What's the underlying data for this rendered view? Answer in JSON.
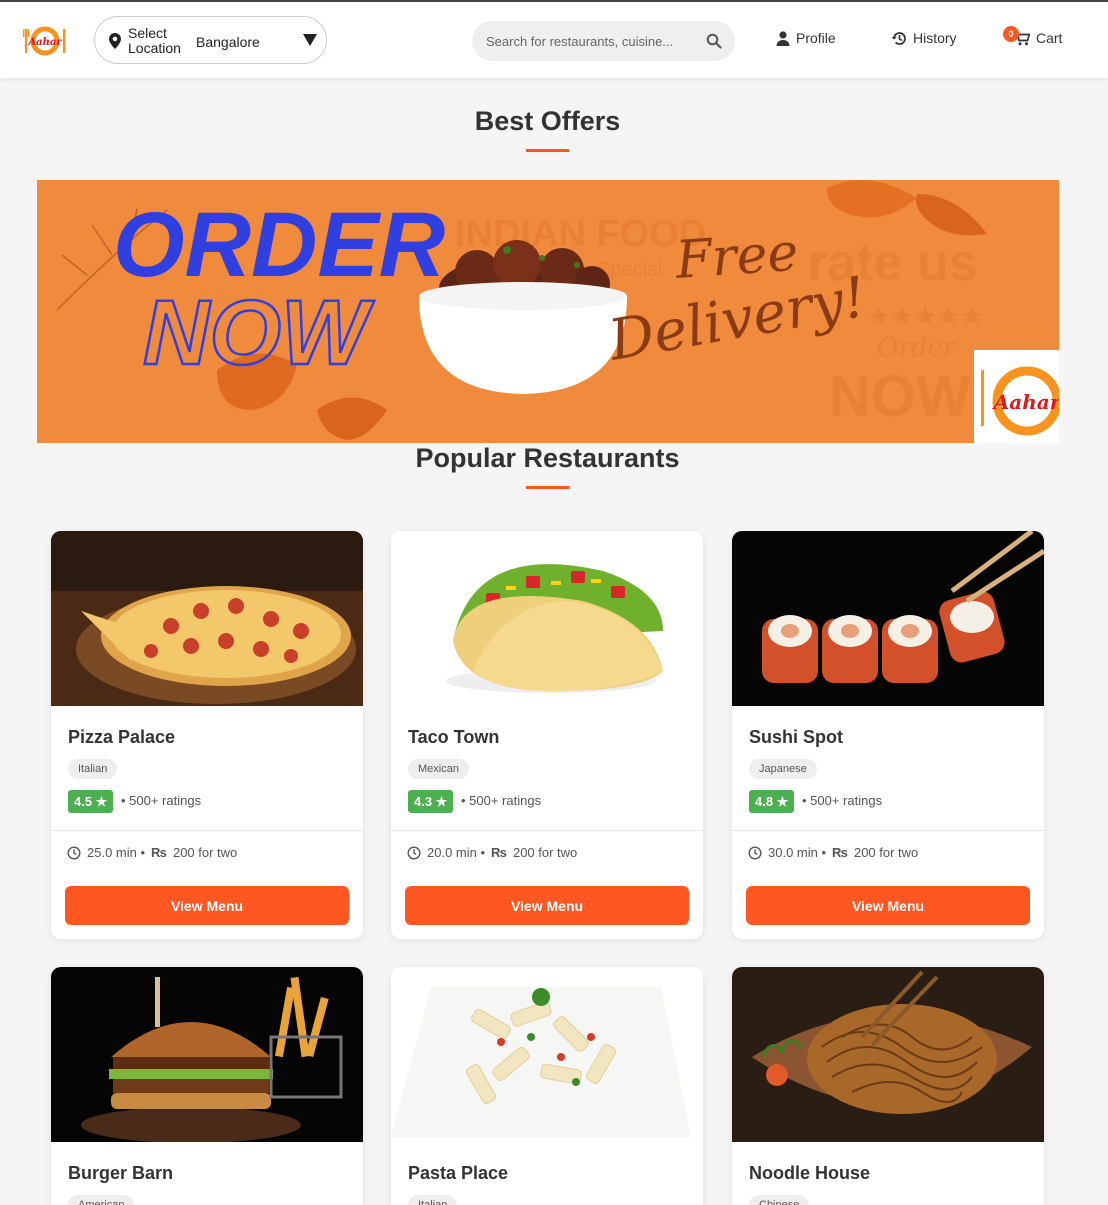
{
  "header": {
    "logo_text": "Aahar",
    "location_label": "Select Location",
    "location_value": "Bangalore",
    "search_placeholder": "Search for restaurants, cuisine...",
    "nav": {
      "profile": "Profile",
      "history": "History",
      "cart": "Cart",
      "cart_count": "0"
    }
  },
  "offers": {
    "title": "Best Offers",
    "banner": {
      "line1": "ORDER",
      "line2": "NOW",
      "free": "Free",
      "delivery": "Delivery!",
      "bg_text_1": "INDIAN FOOD",
      "bg_text_2": "Special",
      "bg_text_3": "rate us",
      "bg_text_4": "Order",
      "bg_text_5": "NOW",
      "logo_text": "Aahar"
    }
  },
  "popular": {
    "title": "Popular Restaurants",
    "button_label": "View Menu",
    "currency_symbol": "₨",
    "restaurants": [
      {
        "name": "Pizza Palace",
        "cuisine": "Italian",
        "rating": "4.5 ★",
        "ratings_count": "• 500+ ratings",
        "time": "25.0 min •",
        "price": "200 for two",
        "image": "pizza"
      },
      {
        "name": "Taco Town",
        "cuisine": "Mexican",
        "rating": "4.3 ★",
        "ratings_count": "• 500+ ratings",
        "time": "20.0 min •",
        "price": "200 for two",
        "image": "taco"
      },
      {
        "name": "Sushi Spot",
        "cuisine": "Japanese",
        "rating": "4.8 ★",
        "ratings_count": "• 500+ ratings",
        "time": "30.0 min •",
        "price": "200 for two",
        "image": "sushi"
      },
      {
        "name": "Burger Barn",
        "cuisine": "American",
        "image": "burger"
      },
      {
        "name": "Pasta Place",
        "cuisine": "Italian",
        "image": "pasta"
      },
      {
        "name": "Noodle House",
        "cuisine": "Chinese",
        "image": "noodles"
      }
    ]
  },
  "colors": {
    "accent": "#ff5722",
    "rating_green": "#4caf50",
    "banner_orange": "#f08a3c",
    "order_blue": "#2f3fe0"
  }
}
